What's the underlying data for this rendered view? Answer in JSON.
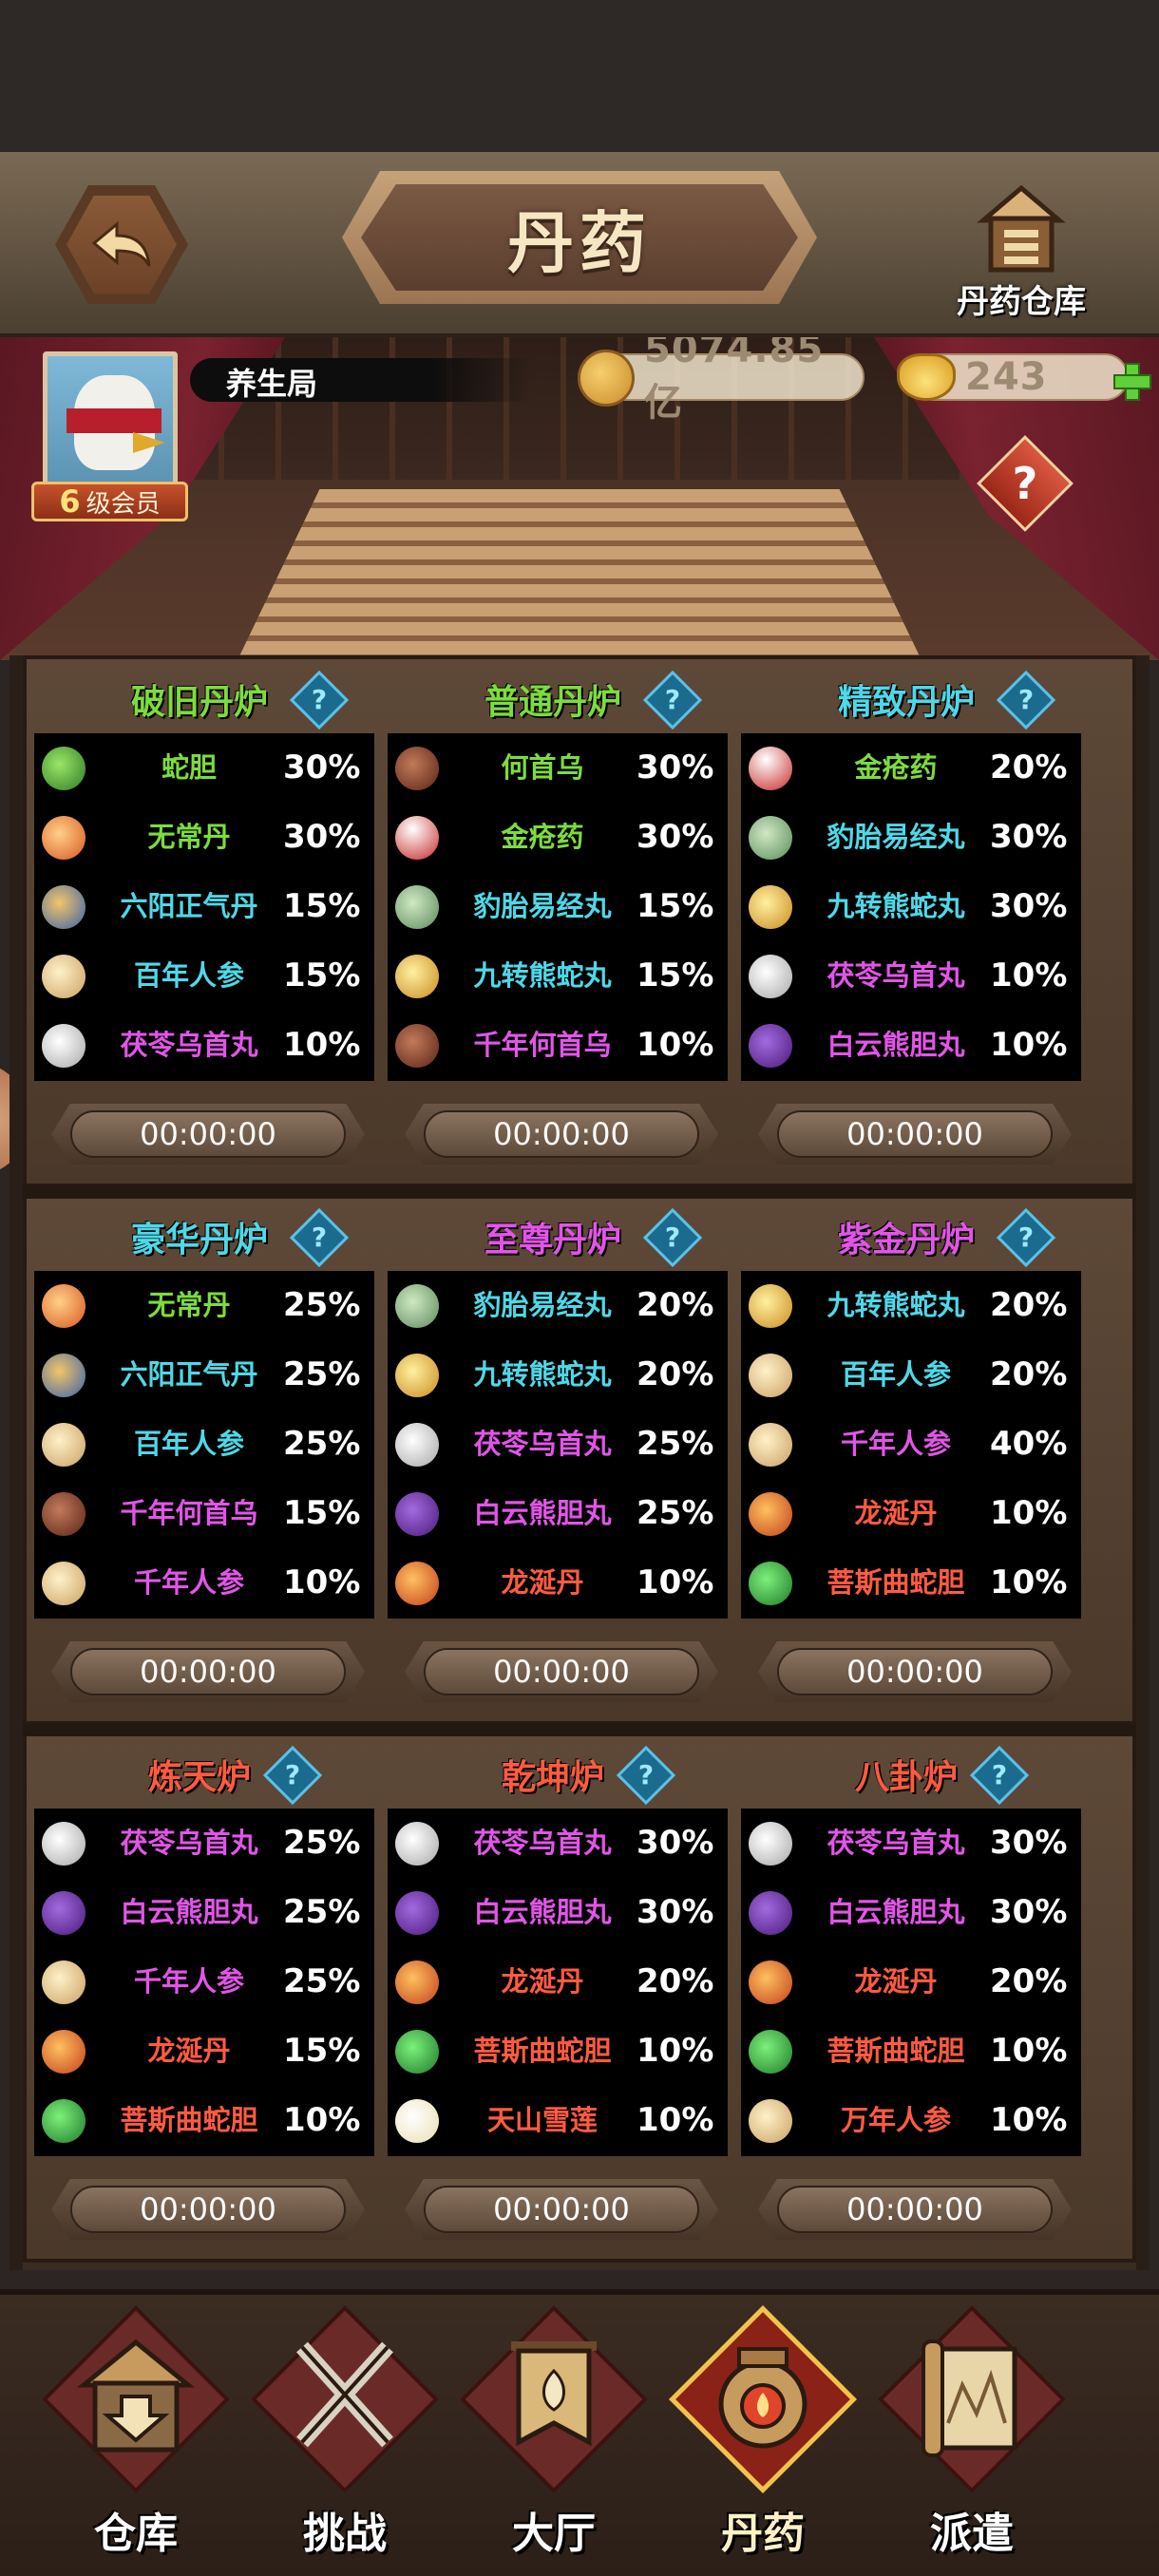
{
  "header": {
    "title": "丹药",
    "warehouse_label": "丹药仓库"
  },
  "profile": {
    "nickname": "养生局",
    "vip_level": "6",
    "vip_label": "级会员",
    "coins": "5074.85亿",
    "ingots": "243"
  },
  "furnaces": [
    {
      "name": "破旧丹炉",
      "name_color": "#7ddc3e",
      "timer": "00:00:00",
      "items": [
        {
          "name": "蛇胆",
          "pct": "30%",
          "color": "green",
          "icon": "snake-gall-icon"
        },
        {
          "name": "无常丹",
          "pct": "30%",
          "color": "green",
          "icon": "wuchang-pill-icon"
        },
        {
          "name": "六阳正气丹",
          "pct": "15%",
          "color": "cyan",
          "icon": "liuyang-pill-icon"
        },
        {
          "name": "百年人参",
          "pct": "15%",
          "color": "cyan",
          "icon": "ginseng-icon"
        },
        {
          "name": "茯苓乌首丸",
          "pct": "10%",
          "color": "purple",
          "icon": "fuling-pill-icon"
        }
      ]
    },
    {
      "name": "普通丹炉",
      "name_color": "#7ddc3e",
      "timer": "00:00:00",
      "items": [
        {
          "name": "何首乌",
          "pct": "30%",
          "color": "green",
          "icon": "heshouwu-icon"
        },
        {
          "name": "金疮药",
          "pct": "30%",
          "color": "green",
          "icon": "wound-medicine-icon"
        },
        {
          "name": "豹胎易经丸",
          "pct": "15%",
          "color": "cyan",
          "icon": "baotai-pill-icon"
        },
        {
          "name": "九转熊蛇丸",
          "pct": "15%",
          "color": "cyan",
          "icon": "jiuzhuan-pill-icon"
        },
        {
          "name": "千年何首乌",
          "pct": "10%",
          "color": "purple",
          "icon": "heshouwu-icon"
        }
      ]
    },
    {
      "name": "精致丹炉",
      "name_color": "#4fd8e8",
      "timer": "00:00:00",
      "items": [
        {
          "name": "金疮药",
          "pct": "20%",
          "color": "green",
          "icon": "wound-medicine-icon"
        },
        {
          "name": "豹胎易经丸",
          "pct": "30%",
          "color": "cyan",
          "icon": "baotai-pill-icon"
        },
        {
          "name": "九转熊蛇丸",
          "pct": "30%",
          "color": "cyan",
          "icon": "jiuzhuan-pill-icon"
        },
        {
          "name": "茯苓乌首丸",
          "pct": "10%",
          "color": "purple",
          "icon": "fuling-pill-icon"
        },
        {
          "name": "白云熊胆丸",
          "pct": "10%",
          "color": "purple",
          "icon": "baiyun-pill-icon"
        }
      ]
    },
    {
      "name": "豪华丹炉",
      "name_color": "#4fd8e8",
      "timer": "00:00:00",
      "items": [
        {
          "name": "无常丹",
          "pct": "25%",
          "color": "green",
          "icon": "wuchang-pill-icon"
        },
        {
          "name": "六阳正气丹",
          "pct": "25%",
          "color": "cyan",
          "icon": "liuyang-pill-icon"
        },
        {
          "name": "百年人参",
          "pct": "25%",
          "color": "cyan",
          "icon": "ginseng-icon"
        },
        {
          "name": "千年何首乌",
          "pct": "15%",
          "color": "purple",
          "icon": "heshouwu-icon"
        },
        {
          "name": "千年人参",
          "pct": "10%",
          "color": "purple",
          "icon": "ginseng-icon"
        }
      ]
    },
    {
      "name": "至尊丹炉",
      "name_color": "#e255e8",
      "timer": "00:00:00",
      "items": [
        {
          "name": "豹胎易经丸",
          "pct": "20%",
          "color": "cyan",
          "icon": "baotai-pill-icon"
        },
        {
          "name": "九转熊蛇丸",
          "pct": "20%",
          "color": "cyan",
          "icon": "jiuzhuan-pill-icon"
        },
        {
          "name": "茯苓乌首丸",
          "pct": "25%",
          "color": "purple",
          "icon": "fuling-pill-icon"
        },
        {
          "name": "白云熊胆丸",
          "pct": "25%",
          "color": "purple",
          "icon": "baiyun-pill-icon"
        },
        {
          "name": "龙涎丹",
          "pct": "10%",
          "color": "red",
          "icon": "dragon-pill-icon"
        }
      ]
    },
    {
      "name": "紫金丹炉",
      "name_color": "#e255e8",
      "timer": "00:00:00",
      "items": [
        {
          "name": "九转熊蛇丸",
          "pct": "20%",
          "color": "cyan",
          "icon": "jiuzhuan-pill-icon"
        },
        {
          "name": "百年人参",
          "pct": "20%",
          "color": "cyan",
          "icon": "ginseng-icon"
        },
        {
          "name": "千年人参",
          "pct": "40%",
          "color": "purple",
          "icon": "ginseng-icon"
        },
        {
          "name": "龙涎丹",
          "pct": "10%",
          "color": "red",
          "icon": "dragon-pill-icon"
        },
        {
          "name": "菩斯曲蛇胆",
          "pct": "10%",
          "color": "red",
          "icon": "pusi-gall-icon"
        }
      ]
    },
    {
      "name": "炼天炉",
      "name_color": "#ff5b41",
      "timer": "00:00:00",
      "items": [
        {
          "name": "茯苓乌首丸",
          "pct": "25%",
          "color": "purple",
          "icon": "fuling-pill-icon"
        },
        {
          "name": "白云熊胆丸",
          "pct": "25%",
          "color": "purple",
          "icon": "baiyun-pill-icon"
        },
        {
          "name": "千年人参",
          "pct": "25%",
          "color": "purple",
          "icon": "ginseng-icon"
        },
        {
          "name": "龙涎丹",
          "pct": "15%",
          "color": "red",
          "icon": "dragon-pill-icon"
        },
        {
          "name": "菩斯曲蛇胆",
          "pct": "10%",
          "color": "red",
          "icon": "pusi-gall-icon"
        }
      ]
    },
    {
      "name": "乾坤炉",
      "name_color": "#ff5b41",
      "timer": "00:00:00",
      "items": [
        {
          "name": "茯苓乌首丸",
          "pct": "30%",
          "color": "purple",
          "icon": "fuling-pill-icon"
        },
        {
          "name": "白云熊胆丸",
          "pct": "30%",
          "color": "purple",
          "icon": "baiyun-pill-icon"
        },
        {
          "name": "龙涎丹",
          "pct": "20%",
          "color": "red",
          "icon": "dragon-pill-icon"
        },
        {
          "name": "菩斯曲蛇胆",
          "pct": "10%",
          "color": "red",
          "icon": "pusi-gall-icon"
        },
        {
          "name": "天山雪莲",
          "pct": "10%",
          "color": "red",
          "icon": "snow-lotus-icon"
        }
      ]
    },
    {
      "name": "八卦炉",
      "name_color": "#ff5b41",
      "timer": "00:00:00",
      "items": [
        {
          "name": "茯苓乌首丸",
          "pct": "30%",
          "color": "purple",
          "icon": "fuling-pill-icon"
        },
        {
          "name": "白云熊胆丸",
          "pct": "30%",
          "color": "purple",
          "icon": "baiyun-pill-icon"
        },
        {
          "name": "龙涎丹",
          "pct": "20%",
          "color": "red",
          "icon": "dragon-pill-icon"
        },
        {
          "name": "菩斯曲蛇胆",
          "pct": "10%",
          "color": "red",
          "icon": "pusi-gall-icon"
        },
        {
          "name": "万年人参",
          "pct": "10%",
          "color": "red",
          "icon": "ginseng-icon"
        }
      ]
    }
  ],
  "bottom_nav": [
    {
      "label": "仓库",
      "icon": "warehouse-icon",
      "active": false
    },
    {
      "label": "挑战",
      "icon": "crossed-swords-icon",
      "active": false
    },
    {
      "label": "大厅",
      "icon": "hall-banner-icon",
      "active": false
    },
    {
      "label": "丹药",
      "icon": "furnace-icon",
      "active": true
    },
    {
      "label": "派遣",
      "icon": "scroll-map-icon",
      "active": false
    }
  ]
}
